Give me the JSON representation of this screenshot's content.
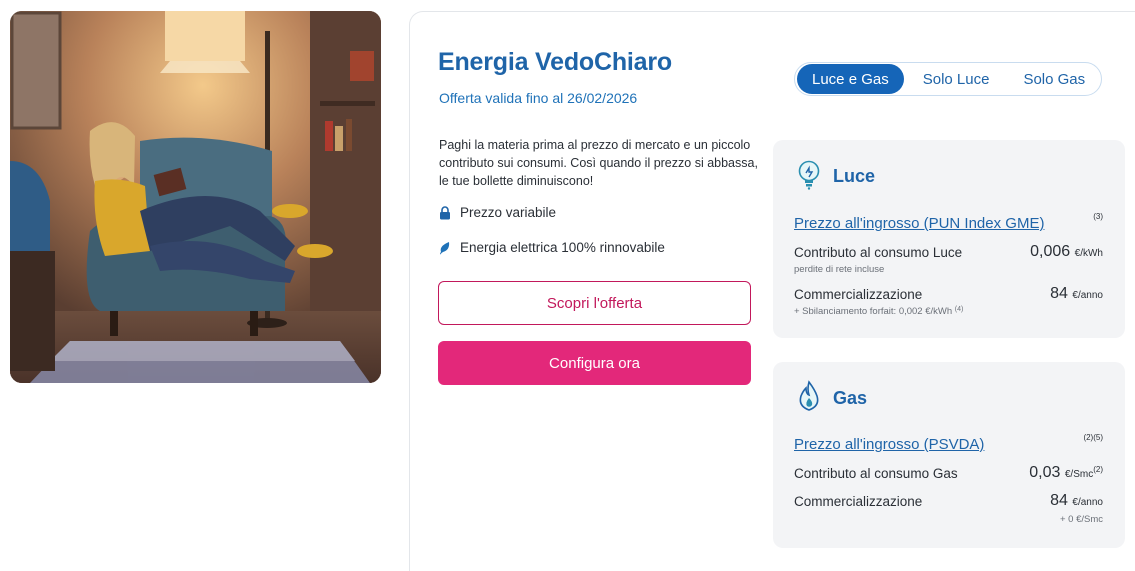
{
  "offer": {
    "title": "Energia VedoChiaro",
    "validity": "Offerta valida fino al 26/02/2026",
    "description": "Paghi la materia prima al prezzo di mercato e un piccolo contributo sui consumi. Così quando il prezzo si abbassa, le tue bollette diminuiscono!",
    "features": [
      {
        "icon": "lock-icon",
        "label": "Prezzo variabile"
      },
      {
        "icon": "leaf-icon",
        "label": "Energia elettrica 100% rinnovabile"
      }
    ],
    "discover_button": "Scopri l'offerta",
    "configure_button": "Configura ora"
  },
  "tabs": [
    {
      "label": "Luce e Gas",
      "active": true
    },
    {
      "label": "Solo Luce",
      "active": false
    },
    {
      "label": "Solo Gas",
      "active": false
    }
  ],
  "luce": {
    "title": "Luce",
    "icon": "lightbulb-icon",
    "price_link": "Prezzo all'ingrosso (PUN Index GME)",
    "price_note": "(3)",
    "contribution_label": "Contributo al consumo Luce",
    "contribution_sub": "perdite di rete incluse",
    "contribution_value": "0,006",
    "contribution_unit": "€/kWh",
    "commercial_label": "Commercializzazione",
    "commercial_sub": "+ Sbilanciamento forfait: 0,002 €/kWh",
    "commercial_sub_note": "(4)",
    "commercial_value": "84",
    "commercial_unit": "€/anno"
  },
  "gas": {
    "title": "Gas",
    "icon": "flame-icon",
    "price_link": "Prezzo all'ingrosso (PSVDA)",
    "price_note": "(2)(5)",
    "contribution_label": "Contributo al consumo Gas",
    "contribution_value": "0,03",
    "contribution_unit": "€/Smc",
    "contribution_note": "(2)",
    "commercial_label": "Commercializzazione",
    "commercial_value": "84",
    "commercial_unit": "€/anno",
    "commercial_extra": "+ 0 €/Smc"
  },
  "colors": {
    "brand_blue": "#1f64a8",
    "tab_active": "#1565b8",
    "pink": "#e3287a",
    "pink_outline": "#c2185b",
    "panel_bg": "#f3f4f6"
  }
}
